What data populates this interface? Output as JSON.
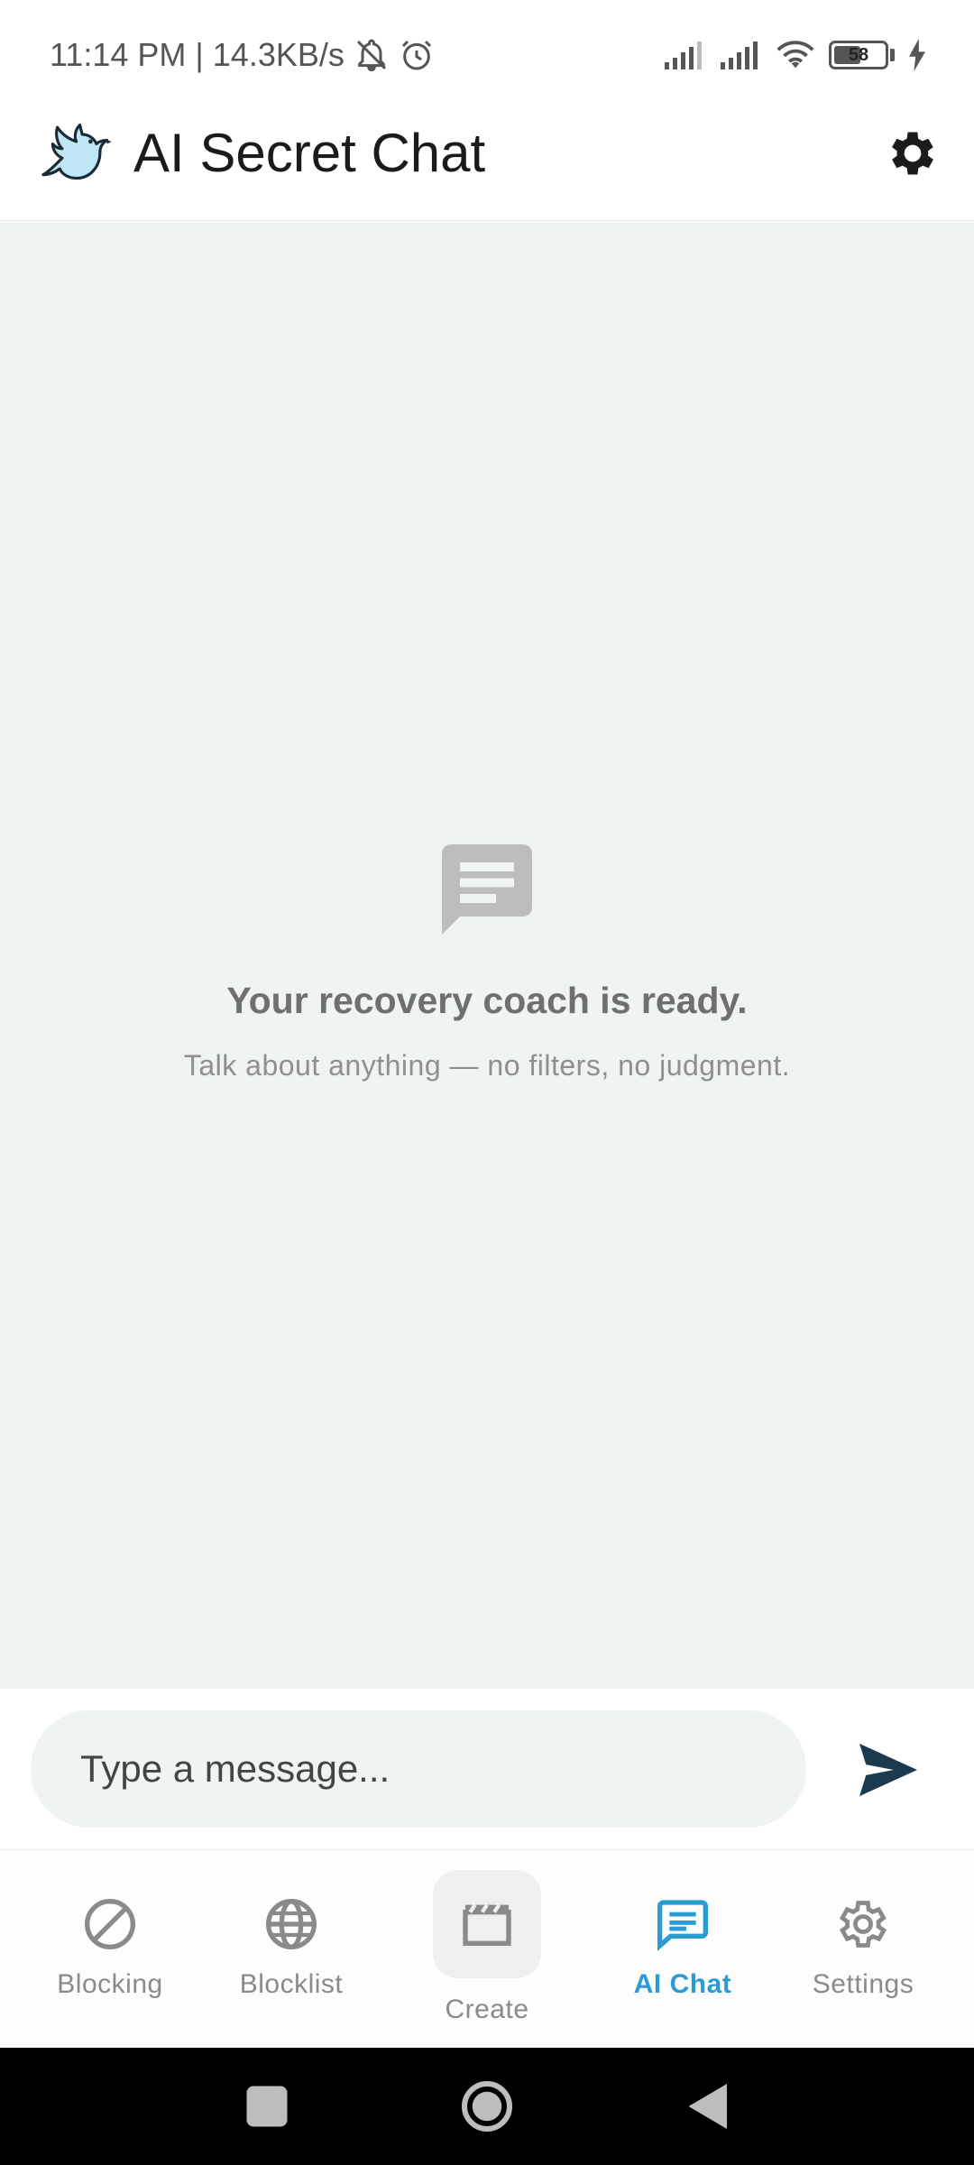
{
  "status_bar": {
    "time_speed": "11:14 PM | 14.3KB/s",
    "battery": "58",
    "battery_level": 0.58
  },
  "app_bar": {
    "title": "AI Secret Chat",
    "logo_icon": "dove-icon",
    "settings_icon": "gear-icon"
  },
  "empty_state": {
    "icon": "chat-bubble-icon",
    "title": "Your recovery coach is ready.",
    "subtitle": "Talk about anything — no filters, no judgment."
  },
  "composer": {
    "placeholder": "Type a message...",
    "send_icon": "send-icon"
  },
  "bottom_nav": {
    "items": [
      {
        "label": "Blocking",
        "icon": "block-icon",
        "active": false
      },
      {
        "label": "Blocklist",
        "icon": "globe-icon",
        "active": false
      },
      {
        "label": "Create",
        "icon": "clapperboard-icon",
        "active": false
      },
      {
        "label": "AI Chat",
        "icon": "chat-bubble-icon",
        "active": true
      },
      {
        "label": "Settings",
        "icon": "gear-icon",
        "active": false
      }
    ]
  },
  "colors": {
    "accent": "#2a9bd3",
    "chat_background": "#eff3f2",
    "send": "#1c3a4f"
  }
}
